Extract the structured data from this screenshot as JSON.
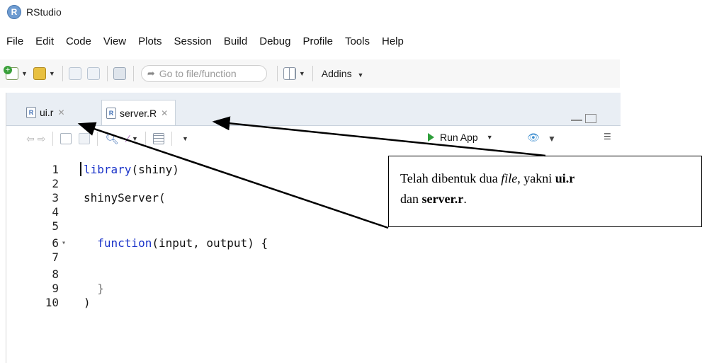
{
  "window": {
    "title": "RStudio",
    "app_icon_letter": "R"
  },
  "menu": [
    "File",
    "Edit",
    "Code",
    "View",
    "Plots",
    "Session",
    "Build",
    "Debug",
    "Profile",
    "Tools",
    "Help"
  ],
  "toolbar": {
    "goto_placeholder": "Go to file/function",
    "addins_label": "Addins"
  },
  "tabs": [
    {
      "label": "ui.r",
      "active": false
    },
    {
      "label": "server.R",
      "active": true
    }
  ],
  "editor_toolbar": {
    "run_app_label": "Run App"
  },
  "code": {
    "line_numbers": [
      "1",
      "2",
      "3",
      "4",
      "5",
      "6",
      "7",
      "8",
      "9",
      "10"
    ],
    "lines": [
      {
        "pre": "",
        "kw": "library",
        "post": "(shiny)"
      },
      {
        "pre": "",
        "kw": "",
        "post": ""
      },
      {
        "pre": "shinyServer(",
        "kw": "",
        "post": ""
      },
      {
        "pre": "",
        "kw": "",
        "post": ""
      },
      {
        "pre": "",
        "kw": "",
        "post": ""
      },
      {
        "pre": "  ",
        "kw": "function",
        "post": "(input, output) {"
      },
      {
        "pre": "",
        "kw": "",
        "post": ""
      },
      {
        "pre": "",
        "kw": "",
        "post": ""
      },
      {
        "pre": "  }",
        "kw": "",
        "post": ""
      },
      {
        "pre": ")",
        "kw": "",
        "post": ""
      }
    ],
    "fold_marker_line": 6,
    "fold_marker": "▾"
  },
  "callout": {
    "line1_a": "Telah dibentuk dua ",
    "line1_file": "file",
    "line1_b": ", yakni ",
    "line1_ui": "ui.r",
    "line2_a": "dan ",
    "line2_server": "server.r",
    "line2_b": "."
  },
  "colors": {
    "keyword": "#1b34c9",
    "run_app_green": "#2e9e3a"
  }
}
